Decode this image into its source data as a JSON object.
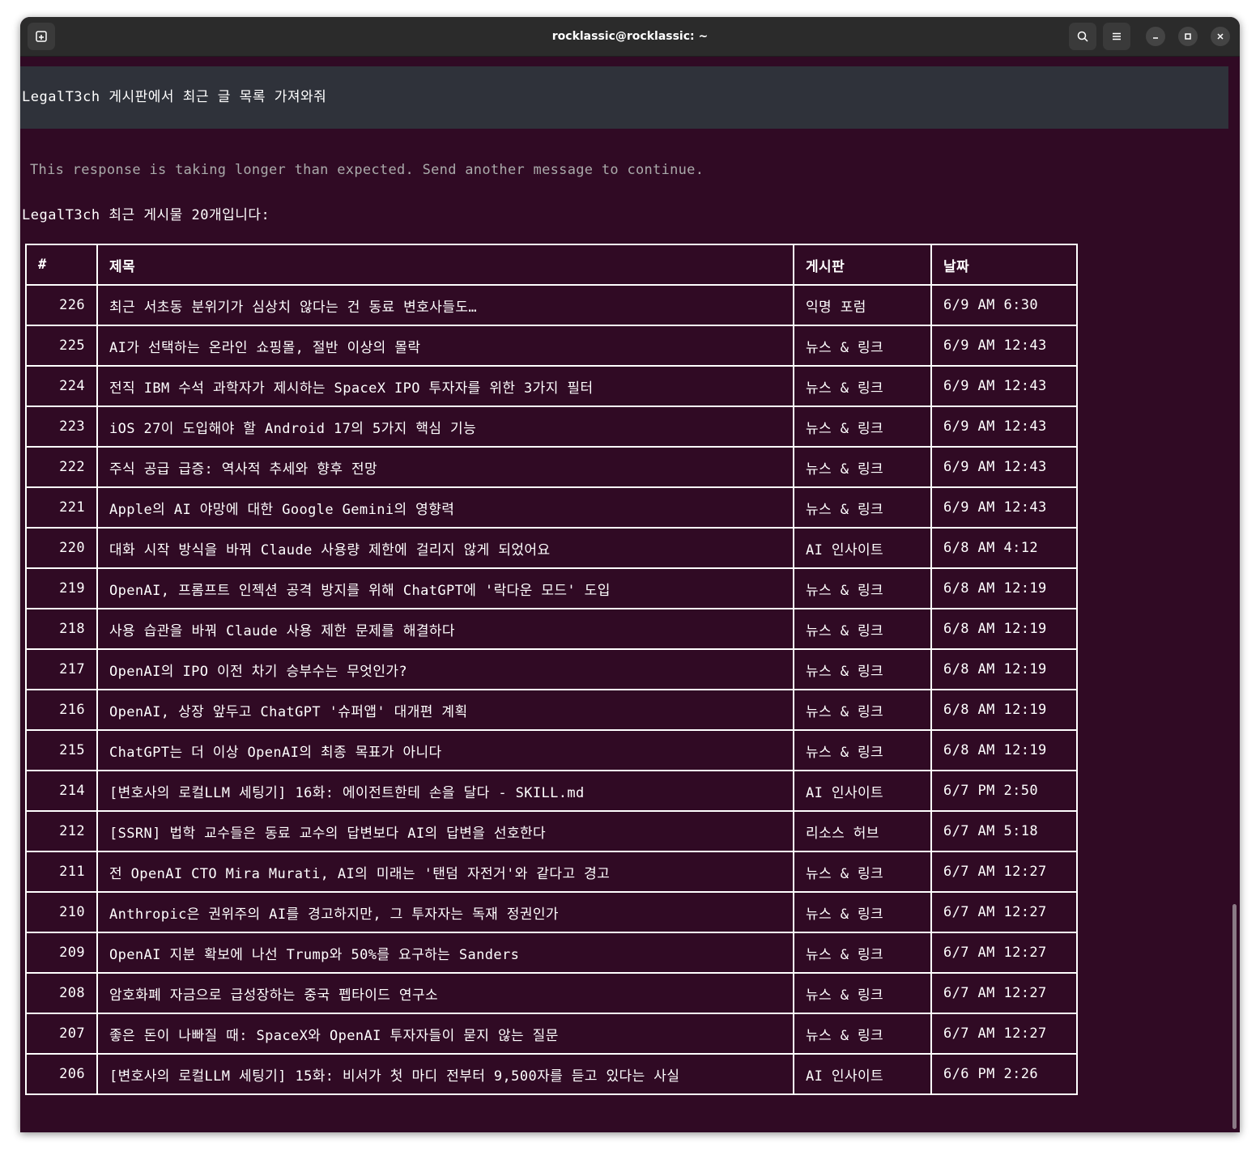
{
  "window": {
    "title": "rocklassic@rocklassic: ~"
  },
  "conversation": {
    "user_prompt": "LegalT3ch 게시판에서 최근 글 목록 가져와줘",
    "notice": "This response is taking longer than expected. Send another message to continue.",
    "intro": "LegalT3ch 최근 게시물 20개입니다:"
  },
  "table": {
    "headers": [
      "#",
      "제목",
      "게시판",
      "날짜"
    ],
    "rows": [
      {
        "num": "226",
        "title": "최근 서초동 분위기가 심상치 않다는 건 동료 변호사들도…",
        "board": "익명 포럼",
        "date": "6/9 AM 6:30"
      },
      {
        "num": "225",
        "title": "AI가 선택하는 온라인 쇼핑몰, 절반 이상의 몰락",
        "board": "뉴스 & 링크",
        "date": "6/9 AM 12:43"
      },
      {
        "num": "224",
        "title": "전직 IBM 수석 과학자가 제시하는 SpaceX IPO 투자자를 위한 3가지 필터",
        "board": "뉴스 & 링크",
        "date": "6/9 AM 12:43"
      },
      {
        "num": "223",
        "title": "iOS 27이 도입해야 할 Android 17의 5가지 핵심 기능",
        "board": "뉴스 & 링크",
        "date": "6/9 AM 12:43"
      },
      {
        "num": "222",
        "title": "주식 공급 급증: 역사적 추세와 향후 전망",
        "board": "뉴스 & 링크",
        "date": "6/9 AM 12:43"
      },
      {
        "num": "221",
        "title": "Apple의 AI 야망에 대한 Google Gemini의 영향력",
        "board": "뉴스 & 링크",
        "date": "6/9 AM 12:43"
      },
      {
        "num": "220",
        "title": "대화 시작 방식을 바꿔 Claude 사용량 제한에 걸리지 않게 되었어요",
        "board": "AI 인사이트",
        "date": "6/8 AM 4:12"
      },
      {
        "num": "219",
        "title": "OpenAI, 프롬프트 인젝션 공격 방지를 위해 ChatGPT에 '락다운 모드' 도입",
        "board": "뉴스 & 링크",
        "date": "6/8 AM 12:19"
      },
      {
        "num": "218",
        "title": "사용 습관을 바꿔 Claude 사용 제한 문제를 해결하다",
        "board": "뉴스 & 링크",
        "date": "6/8 AM 12:19"
      },
      {
        "num": "217",
        "title": "OpenAI의 IPO 이전 차기 승부수는 무엇인가?",
        "board": "뉴스 & 링크",
        "date": "6/8 AM 12:19"
      },
      {
        "num": "216",
        "title": "OpenAI, 상장 앞두고 ChatGPT '슈퍼앱' 대개편 계획",
        "board": "뉴스 & 링크",
        "date": "6/8 AM 12:19"
      },
      {
        "num": "215",
        "title": "ChatGPT는 더 이상 OpenAI의 최종 목표가 아니다",
        "board": "뉴스 & 링크",
        "date": "6/8 AM 12:19"
      },
      {
        "num": "214",
        "title": "[변호사의 로컬LLM 세팅기] 16화: 에이전트한테 손을 달다 - SKILL.md",
        "board": "AI 인사이트",
        "date": "6/7 PM 2:50"
      },
      {
        "num": "212",
        "title": "[SSRN] 법학 교수들은 동료 교수의 답변보다 AI의 답변을 선호한다",
        "board": "리소스 허브",
        "date": "6/7 AM 5:18"
      },
      {
        "num": "211",
        "title": "전 OpenAI CTO Mira Murati, AI의 미래는 '탠덤 자전거'와 같다고 경고",
        "board": "뉴스 & 링크",
        "date": "6/7 AM 12:27"
      },
      {
        "num": "210",
        "title": "Anthropic은 권위주의 AI를 경고하지만, 그 투자자는 독재 정권인가",
        "board": "뉴스 & 링크",
        "date": "6/7 AM 12:27"
      },
      {
        "num": "209",
        "title": "OpenAI 지분 확보에 나선 Trump와 50%를 요구하는 Sanders",
        "board": "뉴스 & 링크",
        "date": "6/7 AM 12:27"
      },
      {
        "num": "208",
        "title": "암호화폐 자금으로 급성장하는 중국 펩타이드 연구소",
        "board": "뉴스 & 링크",
        "date": "6/7 AM 12:27"
      },
      {
        "num": "207",
        "title": "좋은 돈이 나빠질 때: SpaceX와 OpenAI 투자자들이 묻지 않는 질문",
        "board": "뉴스 & 링크",
        "date": "6/7 AM 12:27"
      },
      {
        "num": "206",
        "title": "[변호사의 로컬LLM 세팅기] 15화: 비서가 첫 마디 전부터 9,500자를 듣고 있다는 사실",
        "board": "AI 인사이트",
        "date": "6/6 PM 2:26"
      }
    ]
  },
  "icons": {
    "new_tab": "new-tab-icon",
    "search": "search-icon",
    "menu": "hamburger-menu-icon",
    "minimize": "minimize-icon",
    "maximize": "maximize-icon",
    "close": "close-icon"
  },
  "colors": {
    "terminal_bg": "#300a24",
    "titlebar_bg": "#2b2b2b",
    "prompt_bg": "#2f323a",
    "text": "#ffffff",
    "notice_text": "#aaaaaa"
  }
}
